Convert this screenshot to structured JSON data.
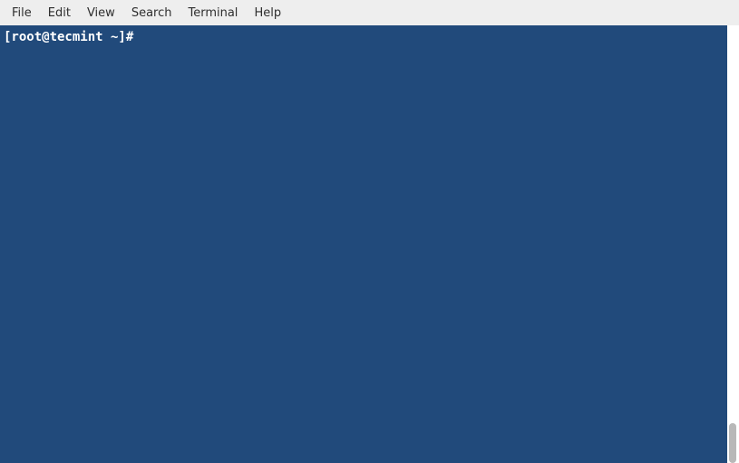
{
  "menubar": {
    "items": [
      {
        "label": "File"
      },
      {
        "label": "Edit"
      },
      {
        "label": "View"
      },
      {
        "label": "Search"
      },
      {
        "label": "Terminal"
      },
      {
        "label": "Help"
      }
    ]
  },
  "terminal": {
    "prompt": "[root@tecmint ~]#",
    "colors": {
      "background": "#214a7b",
      "foreground": "#ffffff"
    }
  }
}
